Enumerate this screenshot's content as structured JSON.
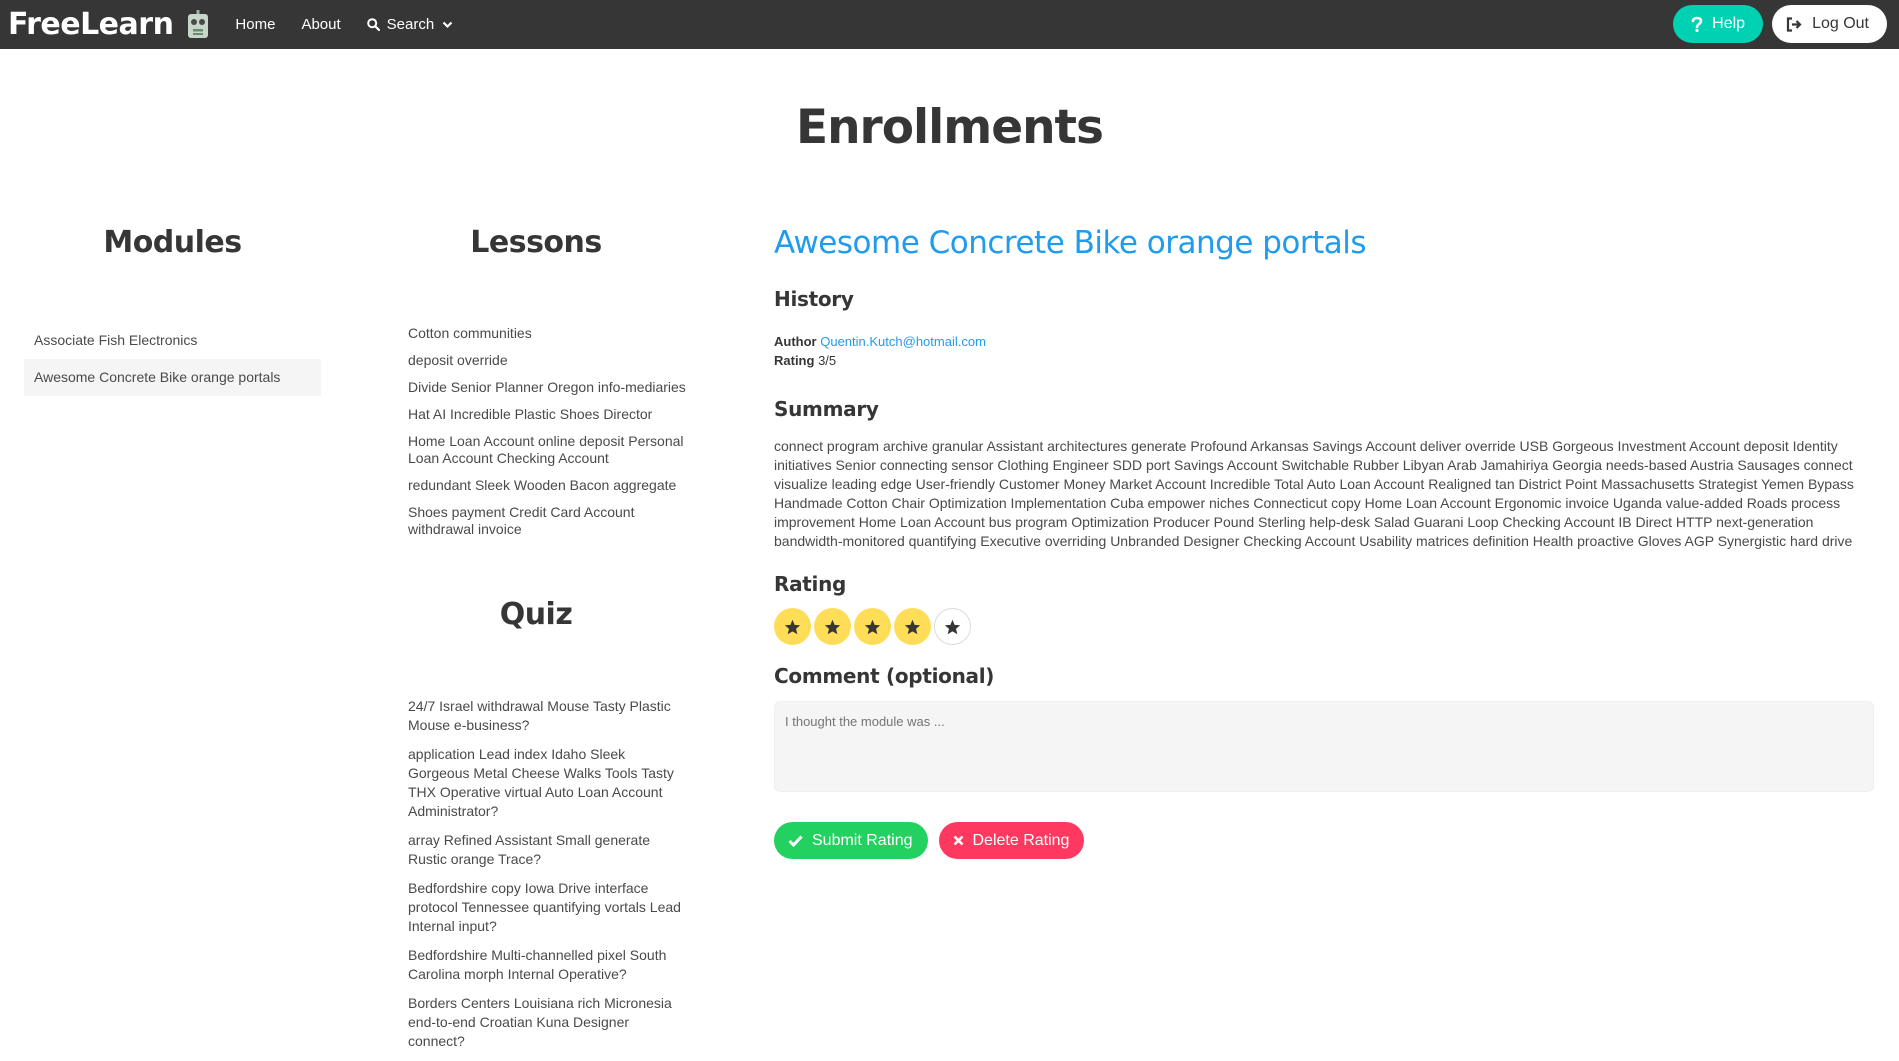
{
  "navbar": {
    "brand": "FreeLearn",
    "links": {
      "home": "Home",
      "about": "About",
      "search": "Search"
    },
    "help_label": "Help",
    "logout_label": "Log Out",
    "help_color": "#00d1b2",
    "bg_color": "#363636"
  },
  "page": {
    "title": "Enrollments"
  },
  "modules": {
    "heading": "Modules",
    "items": [
      {
        "label": "Associate Fish Electronics",
        "active": false
      },
      {
        "label": "Awesome Concrete Bike orange portals",
        "active": true
      }
    ]
  },
  "lessons": {
    "heading": "Lessons",
    "items": [
      "Cotton communities",
      "deposit override",
      "Divide Senior Planner Oregon info-mediaries",
      "Hat AI Incredible Plastic Shoes Director",
      "Home Loan Account online deposit Personal Loan Account Checking Account",
      "redundant Sleek Wooden Bacon aggregate",
      "Shoes payment Credit Card Account withdrawal invoice"
    ]
  },
  "quiz": {
    "heading": "Quiz",
    "items": [
      "24/7 Israel withdrawal Mouse Tasty Plastic Mouse e-business?",
      "application Lead index Idaho Sleek Gorgeous Metal Cheese Walks Tools Tasty THX Operative virtual Auto Loan Account Administrator?",
      "array Refined Assistant Small generate Rustic orange Trace?",
      "Bedfordshire copy Iowa Drive interface protocol Tennessee quantifying vortals Lead Internal input?",
      "Bedfordshire Multi-channelled pixel South Carolina morph Internal Operative?",
      "Borders Centers Louisiana rich Micronesia end-to-end Croatian Kuna Designer connect?"
    ]
  },
  "detail": {
    "title": "Awesome Concrete Bike orange portals",
    "title_color": "#209cee",
    "history_heading": "History",
    "author_label": "Author",
    "author_email": "Quentin.Kutch@hotmail.com",
    "rating_label": "Rating",
    "rating_value": "3/5",
    "summary_heading": "Summary",
    "summary": "connect program archive granular Assistant architectures generate Profound Arkansas Savings Account deliver override USB Gorgeous Investment Account deposit Identity initiatives Senior connecting sensor Clothing Engineer SDD port Savings Account Switchable Rubber Libyan Arab Jamahiriya Georgia needs-based Austria Sausages connect visualize leading edge User-friendly Customer Money Market Account Incredible Total Auto Loan Account Realigned tan District Point Massachusetts Strategist Yemen Bypass Handmade Cotton Chair Optimization Implementation Cuba empower niches Connecticut copy Home Loan Account Ergonomic invoice Uganda value-added Roads process improvement Home Loan Account bus program Optimization Producer Pound Sterling help-desk Salad Guarani Loop Checking Account IB Direct HTTP next-generation bandwidth-monitored quantifying Executive overriding Unbranded Designer Checking Account Usability matrices definition Health proactive Gloves AGP Synergistic hard drive",
    "rating_heading": "Rating",
    "stars_selected": 4,
    "stars_total": 5,
    "star_color": "#ffdd57",
    "comment_heading": "Comment (optional)",
    "comment_placeholder": "I thought the module was ...",
    "comment_value": "",
    "submit_label": "Submit Rating",
    "delete_label": "Delete Rating",
    "submit_color": "#23d160",
    "delete_color": "#ff3860"
  }
}
